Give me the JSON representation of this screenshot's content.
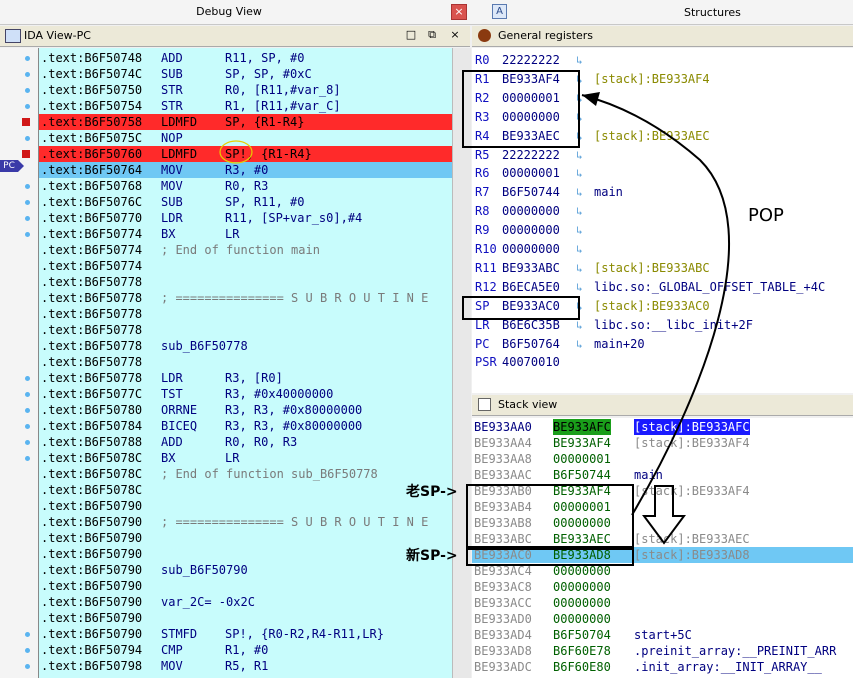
{
  "tabs": {
    "debug_title": "Debug View",
    "close": "×",
    "structures_icon": "A",
    "structures_title": "Structures"
  },
  "ida": {
    "title": "IDA View-PC",
    "buttons": [
      "□",
      "⧉",
      "×"
    ],
    "pc_marker": "PC",
    "rows": [
      {
        "addr": ".text:B6F50748",
        "mn": "ADD",
        "op": "R11, SP, #0",
        "style": "",
        "mark": "dot"
      },
      {
        "addr": ".text:B6F5074C",
        "mn": "SUB",
        "op": "SP, SP, #0xC",
        "style": "",
        "mark": "dot"
      },
      {
        "addr": ".text:B6F50750",
        "mn": "STR",
        "op": "R0, [R11,#var_8]",
        "style": "",
        "mark": "dot"
      },
      {
        "addr": ".text:B6F50754",
        "mn": "STR",
        "op": "R1, [R11,#var_C]",
        "style": "",
        "mark": "dot"
      },
      {
        "addr": ".text:B6F50758",
        "mn": "LDMFD",
        "op": "SP, {R1-R4}",
        "style": "red",
        "mark": "bp"
      },
      {
        "addr": ".text:B6F5075C",
        "mn": "NOP",
        "op": "",
        "style": "",
        "mark": "dot"
      },
      {
        "addr": ".text:B6F50760",
        "mn": "LDMFD",
        "op": "SP!, {R1-R4}",
        "style": "red",
        "mark": "bp"
      },
      {
        "addr": ".text:B6F50764",
        "mn": "MOV",
        "op": "R3, #0",
        "style": "blue",
        "mark": "pc"
      },
      {
        "addr": ".text:B6F50768",
        "mn": "MOV",
        "op": "R0, R3",
        "style": "",
        "mark": "dot"
      },
      {
        "addr": ".text:B6F5076C",
        "mn": "SUB",
        "op": "SP, R11, #0",
        "style": "",
        "mark": "dot"
      },
      {
        "addr": ".text:B6F50770",
        "mn": "LDR",
        "op": "R11, [SP+var_s0],#4",
        "style": "",
        "mark": "dot"
      },
      {
        "addr": ".text:B6F50774",
        "mn": "BX",
        "op": "LR",
        "style": "",
        "mark": "dot"
      },
      {
        "addr": ".text:B6F50774",
        "cmt": "; End of function main",
        "style": "",
        "mark": ""
      },
      {
        "addr": ".text:B6F50774",
        "style": "",
        "mark": ""
      },
      {
        "addr": ".text:B6F50778",
        "style": "",
        "mark": ""
      },
      {
        "addr": ".text:B6F50778",
        "cmt": "; =============== S U B R O U T I N E",
        "style": "",
        "mark": ""
      },
      {
        "addr": ".text:B6F50778",
        "style": "",
        "mark": ""
      },
      {
        "addr": ".text:B6F50778",
        "style": "",
        "mark": ""
      },
      {
        "addr": ".text:B6F50778",
        "lbl": "sub_B6F50778",
        "style": "",
        "mark": ""
      },
      {
        "addr": ".text:B6F50778",
        "style": "",
        "mark": ""
      },
      {
        "addr": ".text:B6F50778",
        "mn": "LDR",
        "op": "R3, [R0]",
        "style": "",
        "mark": "dot"
      },
      {
        "addr": ".text:B6F5077C",
        "mn": "TST",
        "op": "R3, #0x40000000",
        "style": "",
        "mark": "dot"
      },
      {
        "addr": ".text:B6F50780",
        "mn": "ORRNE",
        "op": "R3, R3, #0x80000000",
        "style": "",
        "mark": "dot"
      },
      {
        "addr": ".text:B6F50784",
        "mn": "BICEQ",
        "op": "R3, R3, #0x80000000",
        "style": "",
        "mark": "dot"
      },
      {
        "addr": ".text:B6F50788",
        "mn": "ADD",
        "op": "R0, R0, R3",
        "style": "",
        "mark": "dot"
      },
      {
        "addr": ".text:B6F5078C",
        "mn": "BX",
        "op": "LR",
        "style": "",
        "mark": "dot"
      },
      {
        "addr": ".text:B6F5078C",
        "cmt": "; End of function sub_B6F50778",
        "style": "",
        "mark": ""
      },
      {
        "addr": ".text:B6F5078C",
        "style": "",
        "mark": ""
      },
      {
        "addr": ".text:B6F50790",
        "style": "",
        "mark": ""
      },
      {
        "addr": ".text:B6F50790",
        "cmt": "; =============== S U B R O U T I N E",
        "style": "",
        "mark": ""
      },
      {
        "addr": ".text:B6F50790",
        "style": "",
        "mark": ""
      },
      {
        "addr": ".text:B6F50790",
        "style": "",
        "mark": ""
      },
      {
        "addr": ".text:B6F50790",
        "lbl": "sub_B6F50790",
        "style": "",
        "mark": ""
      },
      {
        "addr": ".text:B6F50790",
        "style": "",
        "mark": ""
      },
      {
        "addr": ".text:B6F50790",
        "lbl": "var_2C= -0x2C",
        "style": "",
        "mark": ""
      },
      {
        "addr": ".text:B6F50790",
        "style": "",
        "mark": ""
      },
      {
        "addr": ".text:B6F50790",
        "mn": "STMFD",
        "op": "SP!, {R0-R2,R4-R11,LR}",
        "style": "",
        "mark": "dot"
      },
      {
        "addr": ".text:B6F50794",
        "mn": "CMP",
        "op": "R1, #0",
        "style": "",
        "mark": "dot"
      },
      {
        "addr": ".text:B6F50798",
        "mn": "MOV",
        "op": "R5, R1",
        "style": "",
        "mark": "dot"
      }
    ]
  },
  "registers": {
    "title": "General registers",
    "rows": [
      {
        "name": "R0",
        "val": "22222222",
        "arrow": "↳",
        "desc": "",
        "color": ""
      },
      {
        "name": "R1",
        "val": "BE933AF4",
        "arrow": "↳",
        "desc": "[stack]:BE933AF4",
        "color": "#8a8a00"
      },
      {
        "name": "R2",
        "val": "00000001",
        "arrow": "↳",
        "desc": "",
        "color": ""
      },
      {
        "name": "R3",
        "val": "00000000",
        "arrow": "↳",
        "desc": "",
        "color": ""
      },
      {
        "name": "R4",
        "val": "BE933AEC",
        "arrow": "↳",
        "desc": "[stack]:BE933AEC",
        "color": "#8a8a00"
      },
      {
        "name": "R5",
        "val": "22222222",
        "arrow": "↳",
        "desc": "",
        "color": ""
      },
      {
        "name": "R6",
        "val": "00000001",
        "arrow": "↳",
        "desc": "",
        "color": ""
      },
      {
        "name": "R7",
        "val": "B6F50744",
        "arrow": "↳",
        "desc": "main",
        "color": "#000080"
      },
      {
        "name": "R8",
        "val": "00000000",
        "arrow": "↳",
        "desc": "",
        "color": ""
      },
      {
        "name": "R9",
        "val": "00000000",
        "arrow": "↳",
        "desc": "",
        "color": ""
      },
      {
        "name": "R10",
        "val": "00000000",
        "arrow": "↳",
        "desc": "",
        "color": ""
      },
      {
        "name": "R11",
        "val": "BE933ABC",
        "arrow": "↳",
        "desc": "[stack]:BE933ABC",
        "color": "#8a8a00"
      },
      {
        "name": "R12",
        "val": "B6ECA5E0",
        "arrow": "↳",
        "desc": "libc.so:_GLOBAL_OFFSET_TABLE_+4C",
        "color": "#000080"
      },
      {
        "name": "SP",
        "val": "BE933AC0",
        "arrow": "↳",
        "desc": "[stack]:BE933AC0",
        "color": "#8a8a00"
      },
      {
        "name": "LR",
        "val": "B6E6C35B",
        "arrow": "↳",
        "desc": "libc.so:__libc_init+2F",
        "color": "#000080"
      },
      {
        "name": "PC",
        "val": "B6F50764",
        "arrow": "↳",
        "desc": "main+20",
        "color": "#000080"
      },
      {
        "name": "PSR",
        "val": "40070010",
        "arrow": "",
        "desc": "",
        "color": ""
      }
    ]
  },
  "stack": {
    "title": "Stack view",
    "rows": [
      {
        "addr": "BE933AA0",
        "val": "BE933AFC",
        "desc": "[stack]:BE933AFC",
        "style": "first"
      },
      {
        "addr": "BE933AA4",
        "val": "BE933AF4",
        "desc": "[stack]:BE933AF4",
        "style": ""
      },
      {
        "addr": "BE933AA8",
        "val": "00000001",
        "desc": "",
        "style": ""
      },
      {
        "addr": "BE933AAC",
        "val": "B6F50744",
        "desc": "main",
        "style": ""
      },
      {
        "addr": "BE933AB0",
        "val": "BE933AF4",
        "desc": "[stack]:BE933AF4",
        "style": ""
      },
      {
        "addr": "BE933AB4",
        "val": "00000001",
        "desc": "",
        "style": ""
      },
      {
        "addr": "BE933AB8",
        "val": "00000000",
        "desc": "",
        "style": ""
      },
      {
        "addr": "BE933ABC",
        "val": "BE933AEC",
        "desc": "[stack]:BE933AEC",
        "style": ""
      },
      {
        "addr": "BE933AC0",
        "val": "BE933AD8",
        "desc": "[stack]:BE933AD8",
        "style": "hl"
      },
      {
        "addr": "BE933AC4",
        "val": "00000000",
        "desc": "",
        "style": ""
      },
      {
        "addr": "BE933AC8",
        "val": "00000000",
        "desc": "",
        "style": ""
      },
      {
        "addr": "BE933ACC",
        "val": "00000000",
        "desc": "",
        "style": ""
      },
      {
        "addr": "BE933AD0",
        "val": "00000000",
        "desc": "",
        "style": ""
      },
      {
        "addr": "BE933AD4",
        "val": "B6F50704",
        "desc": "start+5C",
        "style": ""
      },
      {
        "addr": "BE933AD8",
        "val": "B6F60E78",
        "desc": ".preinit_array:__PREINIT_ARR",
        "style": ""
      },
      {
        "addr": "BE933ADC",
        "val": "B6F60E80",
        "desc": ".init_array:__INIT_ARRAY__",
        "style": ""
      }
    ]
  },
  "annotations": {
    "pop": "POP",
    "old_sp": "老SP->",
    "new_sp": "新SP->"
  }
}
